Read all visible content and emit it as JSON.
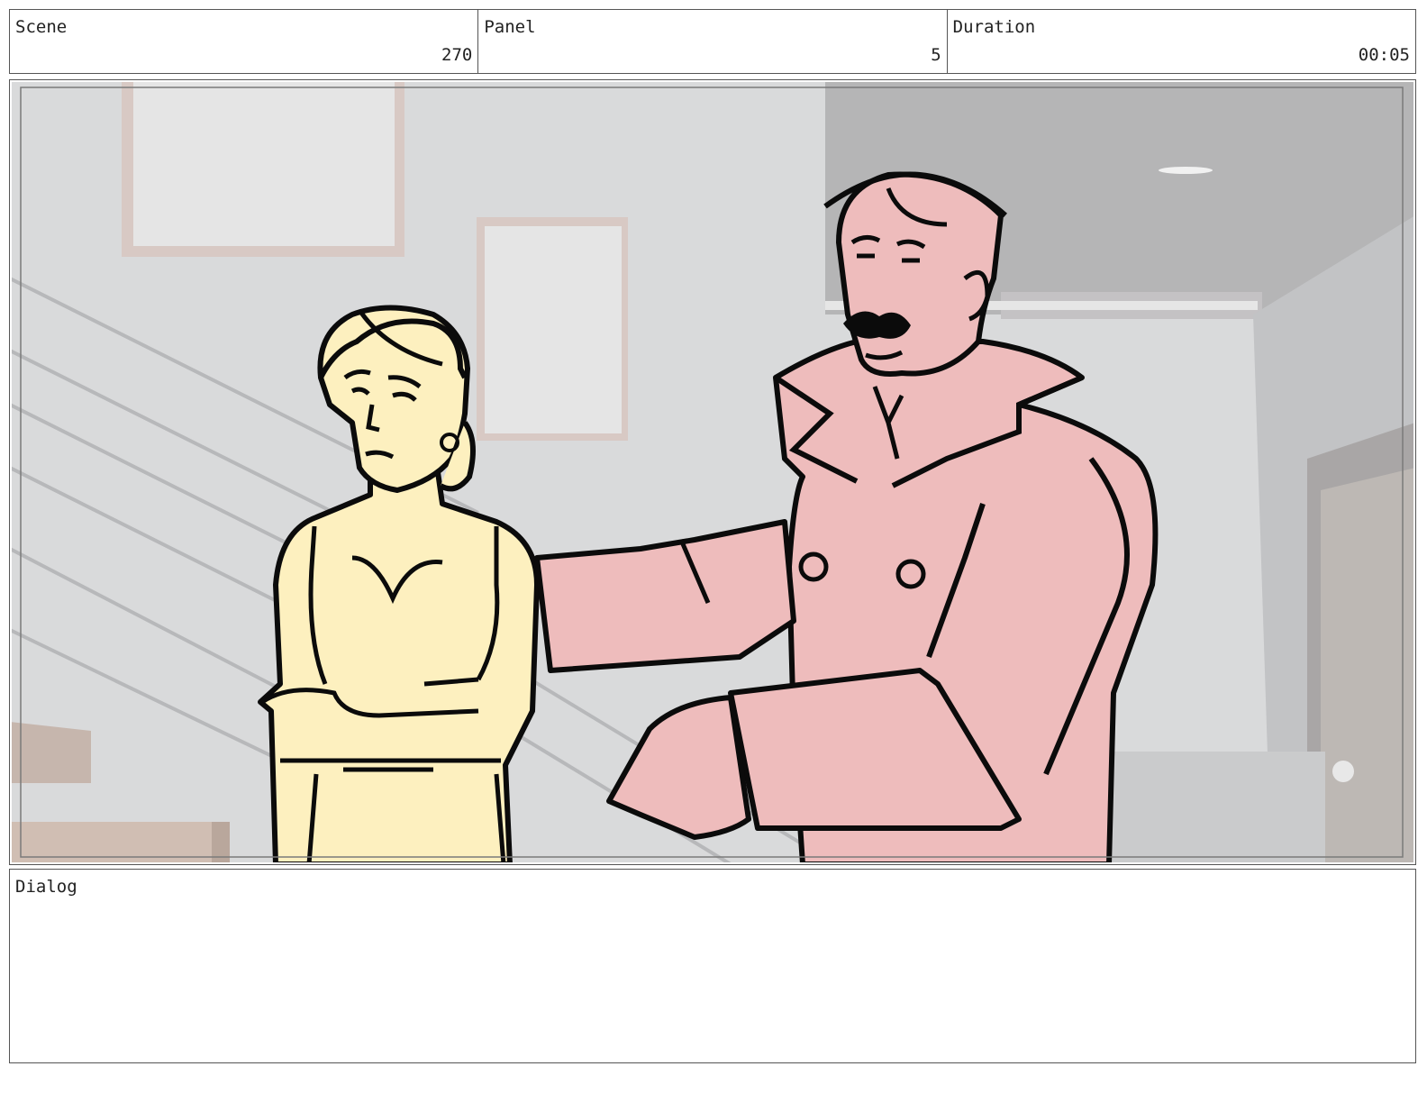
{
  "header": {
    "scene_label": "Scene",
    "scene_value": "270",
    "panel_label": "Panel",
    "panel_value": "5",
    "duration_label": "Duration",
    "duration_value": "00:05"
  },
  "dialog": {
    "label": "Dialog",
    "text": ""
  },
  "colors": {
    "woman_fill": "#fdf0bf",
    "man_fill": "#eebcbc",
    "wall": "#d8d9da",
    "ceiling": "#b4b4b4",
    "line": "#0b0b0b"
  }
}
